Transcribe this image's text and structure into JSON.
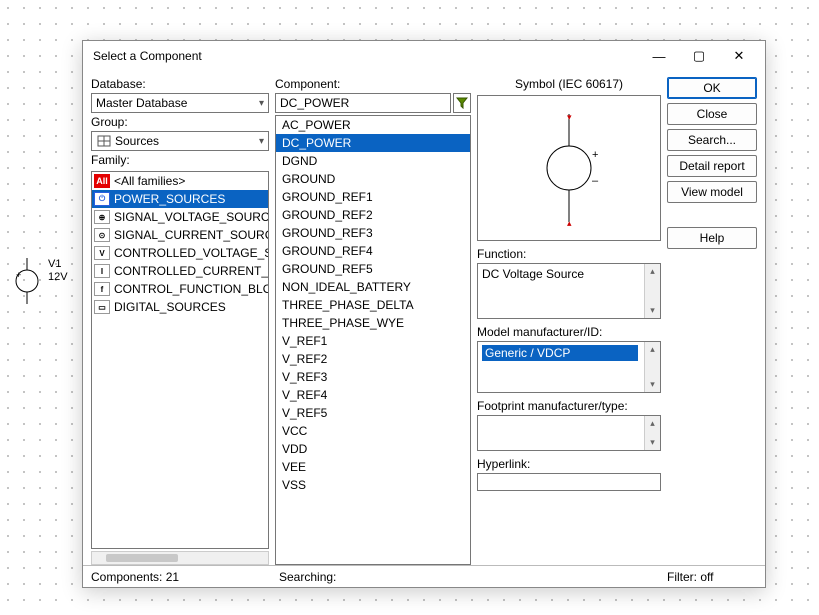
{
  "dialog": {
    "title": "Select a Component",
    "labels": {
      "database": "Database:",
      "group": "Group:",
      "family": "Family:",
      "component": "Component:",
      "symbol": "Symbol (IEC 60617)",
      "function": "Function:",
      "model_mfr": "Model manufacturer/ID:",
      "footprint": "Footprint manufacturer/type:",
      "hyperlink": "Hyperlink:"
    },
    "database": "Master Database",
    "group": "Sources",
    "family_items": [
      {
        "label": "<All families>",
        "cls": "all",
        "icon": "All"
      },
      {
        "label": "POWER_SOURCES",
        "cls": "pwr sel",
        "icon": "⏻"
      },
      {
        "label": "SIGNAL_VOLTAGE_SOURCES",
        "cls": "",
        "icon": "⊕"
      },
      {
        "label": "SIGNAL_CURRENT_SOURCES",
        "cls": "",
        "icon": "⊙"
      },
      {
        "label": "CONTROLLED_VOLTAGE_SOURCES",
        "cls": "",
        "icon": "V"
      },
      {
        "label": "CONTROLLED_CURRENT_SOURCES",
        "cls": "",
        "icon": "I"
      },
      {
        "label": "CONTROL_FUNCTION_BLOCKS",
        "cls": "",
        "icon": "f"
      },
      {
        "label": "DIGITAL_SOURCES",
        "cls": "",
        "icon": "▭"
      }
    ],
    "component_value": "DC_POWER",
    "component_items": [
      "AC_POWER",
      "DC_POWER",
      "DGND",
      "GROUND",
      "GROUND_REF1",
      "GROUND_REF2",
      "GROUND_REF3",
      "GROUND_REF4",
      "GROUND_REF5",
      "NON_IDEAL_BATTERY",
      "THREE_PHASE_DELTA",
      "THREE_PHASE_WYE",
      "V_REF1",
      "V_REF2",
      "V_REF3",
      "V_REF4",
      "V_REF5",
      "VCC",
      "VDD",
      "VEE",
      "VSS"
    ],
    "component_selected": "DC_POWER",
    "function_text": "DC Voltage Source",
    "model_mfr_item": "Generic / VDCP"
  },
  "buttons": {
    "ok": "OK",
    "close": "Close",
    "search": "Search...",
    "detail": "Detail report",
    "view": "View model",
    "help": "Help"
  },
  "status": {
    "components_label": "Components:",
    "components_count": "21",
    "searching_label": "Searching:",
    "filter_label": "Filter:",
    "filter_value": "off"
  },
  "placed": {
    "ref": "V1",
    "val": "12V"
  },
  "icons": {
    "plus": "+",
    "minus": "–"
  }
}
